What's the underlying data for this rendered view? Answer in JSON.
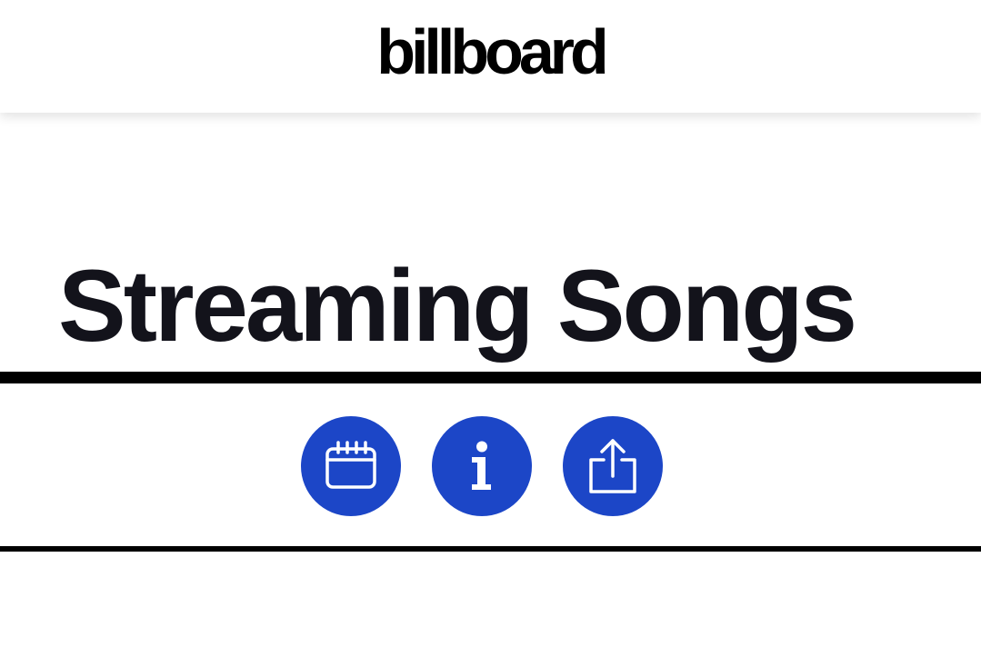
{
  "header": {
    "logo_text": "billboard"
  },
  "page": {
    "title": "Streaming Songs"
  },
  "actions": {
    "buttons": [
      {
        "name": "calendar",
        "icon": "calendar-icon"
      },
      {
        "name": "info",
        "icon": "info-icon"
      },
      {
        "name": "share",
        "icon": "share-icon"
      }
    ]
  },
  "colors": {
    "accent": "#1c46c7",
    "title_text": "#13131b",
    "rule": "#000000"
  }
}
